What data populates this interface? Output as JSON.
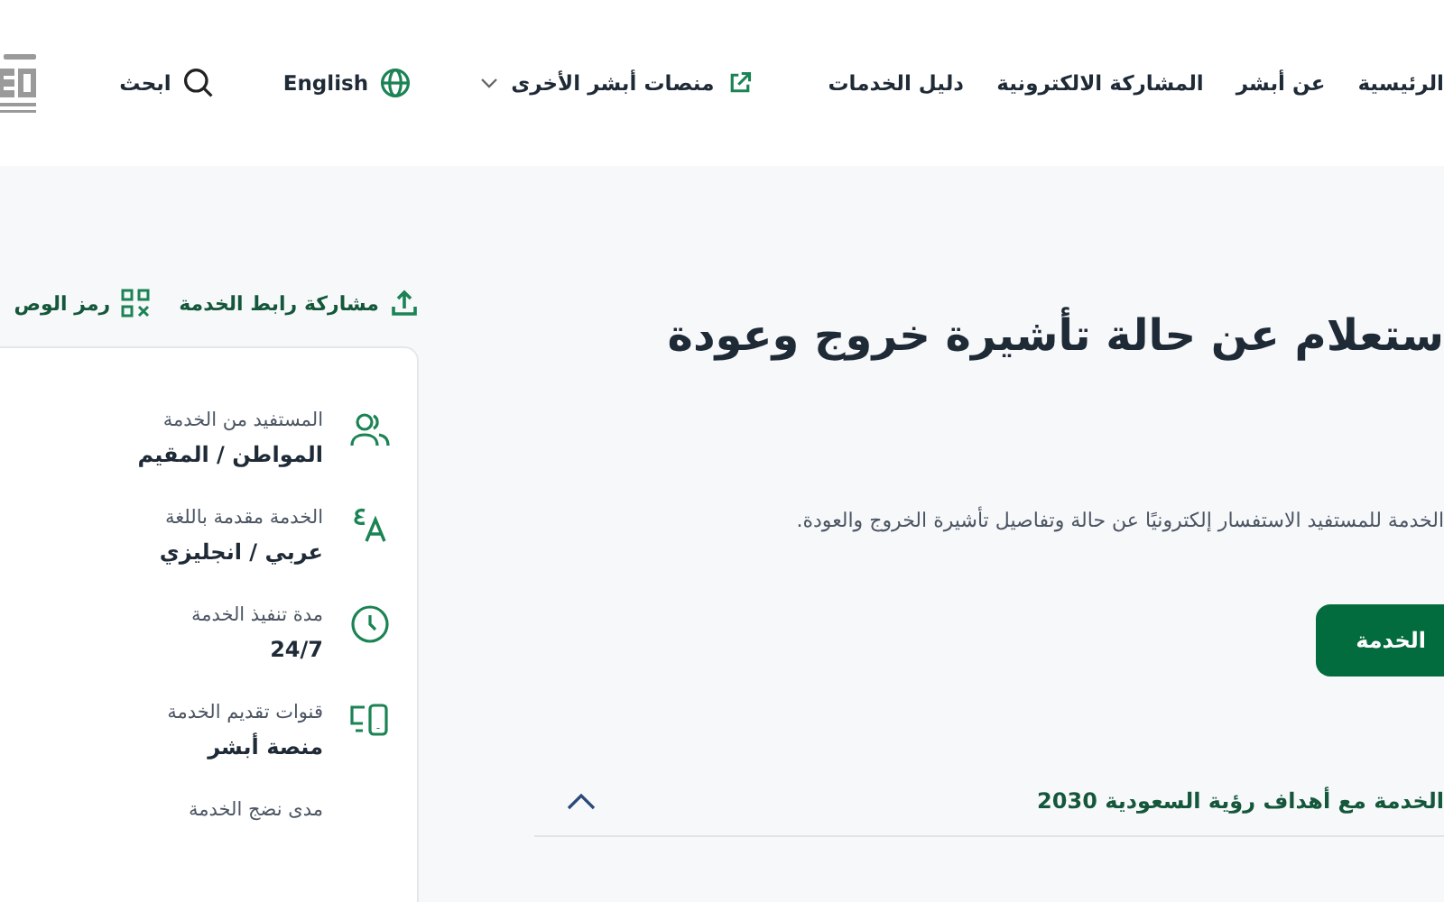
{
  "nav": {
    "links": [
      {
        "label": "الرئيسية"
      },
      {
        "label": "عن أبشر"
      },
      {
        "label": "المشاركة الالكترونية"
      },
      {
        "label": "دليل الخدمات"
      }
    ],
    "platforms_menu": {
      "label": "منصات أبشر الأخرى"
    },
    "language": "English",
    "search": "ابحث"
  },
  "sidebar": {
    "actions": [
      {
        "label": "مشاركة رابط الخدمة",
        "kind": "share"
      },
      {
        "label": "رمز الوص",
        "kind": "qr"
      }
    ],
    "details": [
      {
        "label": "المستفيد من الخدمة",
        "value": "المواطن / المقيم",
        "kind": "users"
      },
      {
        "label": "الخدمة مقدمة باللغة",
        "value": "عربي / انجليزي",
        "kind": "language"
      },
      {
        "label": "مدة تنفيذ الخدمة",
        "value": "24/7",
        "kind": "clock"
      },
      {
        "label": "قنوات تقديم الخدمة",
        "value": "منصة أبشر",
        "kind": "devices"
      },
      {
        "label": "مدى نضج الخدمة",
        "kind": "maturity"
      }
    ]
  },
  "page": {
    "title": "ستعلام عن حالة تأشيرة خروج وعودة",
    "description": "الخدمة للمستفيد الاستفسار إلكترونيًا عن حالة وتفاصيل تأشيرة الخروج والعودة.",
    "start_button": "الخدمة",
    "accordion": {
      "title": "الخدمة مع أهداف رؤية السعودية 2030",
      "expanded": true
    }
  }
}
